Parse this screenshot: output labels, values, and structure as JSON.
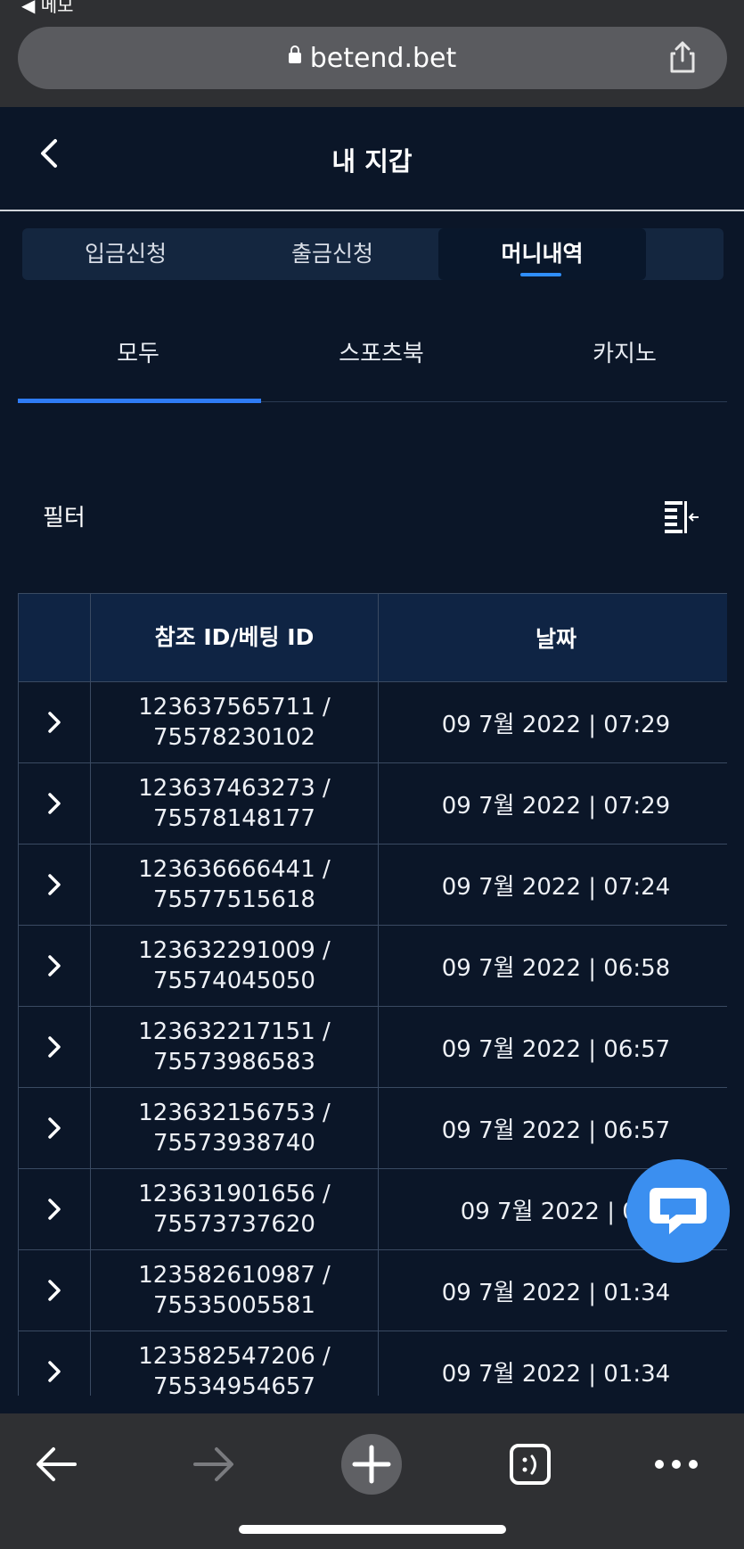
{
  "browser": {
    "back_app_label": "◀ 메모",
    "url": "betend.bet"
  },
  "header": {
    "title": "내 지갑"
  },
  "tabs": [
    {
      "label": "입금신청",
      "active": false
    },
    {
      "label": "출금신청",
      "active": false
    },
    {
      "label": "머니내역",
      "active": true
    }
  ],
  "subtabs": [
    {
      "label": "모두",
      "active": true
    },
    {
      "label": "스포츠북",
      "active": false
    },
    {
      "label": "카지노",
      "active": false
    }
  ],
  "filter": {
    "label": "필터"
  },
  "table": {
    "columns": [
      "",
      "참조 ID/베팅 ID",
      "날짜"
    ],
    "rows": [
      {
        "ref": "123637565711 /",
        "bet": "75578230102",
        "date": "09 7월 2022 | 07:29"
      },
      {
        "ref": "123637463273 /",
        "bet": "75578148177",
        "date": "09 7월 2022 | 07:29"
      },
      {
        "ref": "123636666441 /",
        "bet": "75577515618",
        "date": "09 7월 2022 | 07:24"
      },
      {
        "ref": "123632291009 /",
        "bet": "75574045050",
        "date": "09 7월 2022 | 06:58"
      },
      {
        "ref": "123632217151 /",
        "bet": "75573986583",
        "date": "09 7월 2022 | 06:57"
      },
      {
        "ref": "123632156753 /",
        "bet": "75573938740",
        "date": "09 7월 2022 | 06:57"
      },
      {
        "ref": "123631901656 /",
        "bet": "75573737620",
        "date": "09 7월 2022 | 06"
      },
      {
        "ref": "123582610987 /",
        "bet": "75535005581",
        "date": "09 7월 2022 | 01:34"
      },
      {
        "ref": "123582547206 /",
        "bet": "75534954657",
        "date": "09 7월 2022 | 01:34"
      }
    ]
  },
  "colors": {
    "background": "#0b1628",
    "accent": "#2f7cf6",
    "chat_button": "#3b8ff0"
  },
  "icons": [
    "lock-icon",
    "share-icon",
    "back-chevron-icon",
    "filter-icon",
    "row-expand-chevron-icon",
    "chat-icon",
    "browser-back-icon",
    "browser-forward-icon",
    "new-tab-icon",
    "tabs-icon",
    "more-icon"
  ]
}
